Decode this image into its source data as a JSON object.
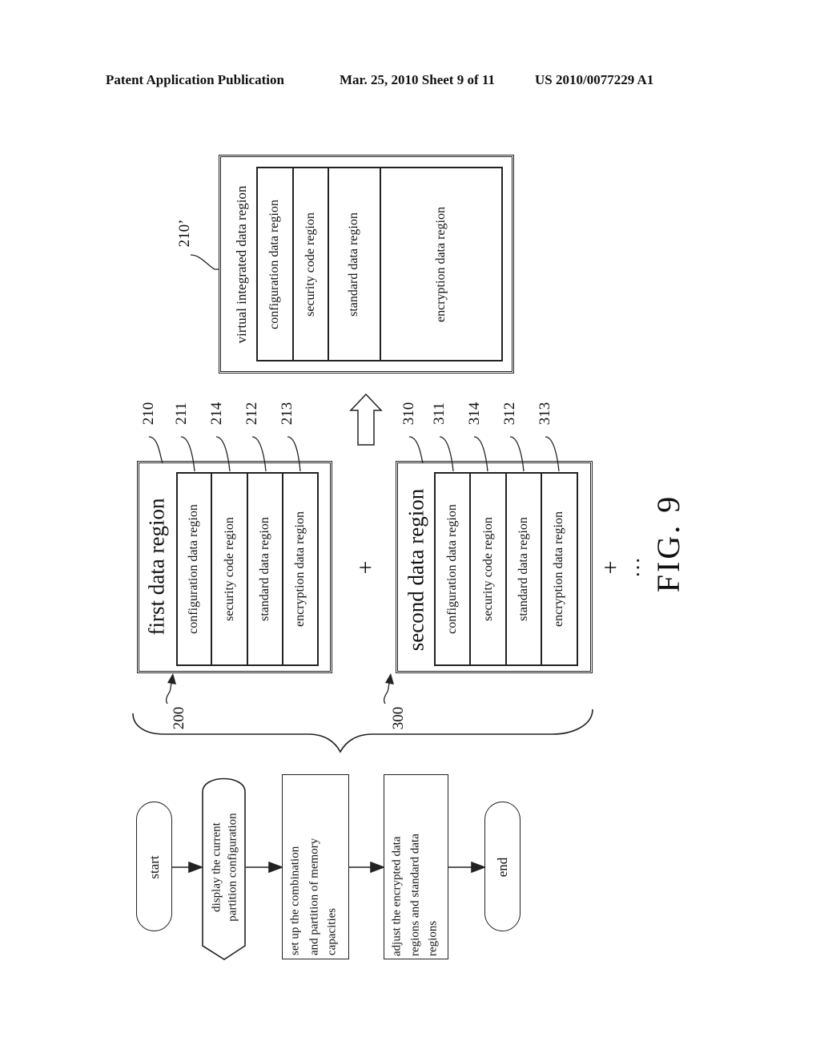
{
  "header": {
    "publication": "Patent Application Publication",
    "date_sheet": "Mar. 25, 2010  Sheet 9 of 11",
    "number": "US 2010/0077229 A1"
  },
  "figure_label": "FIG. 9",
  "virtual_region": {
    "ref": "210’",
    "title": "virtual integrated data region",
    "cells": [
      "configuration data region",
      "security code region",
      "standard data region",
      "encryption data region"
    ]
  },
  "first_region": {
    "group_ref": "200",
    "ref": "210",
    "title": "first data region",
    "cells": [
      {
        "ref": "211",
        "label": "configuration data region"
      },
      {
        "ref": "214",
        "label": "security code region"
      },
      {
        "ref": "212",
        "label": "standard data region"
      },
      {
        "ref": "213",
        "label": "encryption data region"
      }
    ]
  },
  "second_region": {
    "group_ref": "300",
    "ref": "310",
    "title": "second data region",
    "cells": [
      {
        "ref": "311",
        "label": "configuration data region"
      },
      {
        "ref": "314",
        "label": "security code region"
      },
      {
        "ref": "312",
        "label": "standard data region"
      },
      {
        "ref": "313",
        "label": "encryption data region"
      }
    ]
  },
  "operators": {
    "plus": "+",
    "ellipsis": "…"
  },
  "flow": {
    "start": "start",
    "display_line1": "display the current",
    "display_line2": "partition configuration",
    "setup_line1": "set up the combination",
    "setup_line2": "and  partition of memory",
    "setup_line3": "capacities",
    "adjust_line1": "adjust the encrypted data",
    "adjust_line2": "regions and standard data",
    "adjust_line3": "regions",
    "end": "end"
  }
}
